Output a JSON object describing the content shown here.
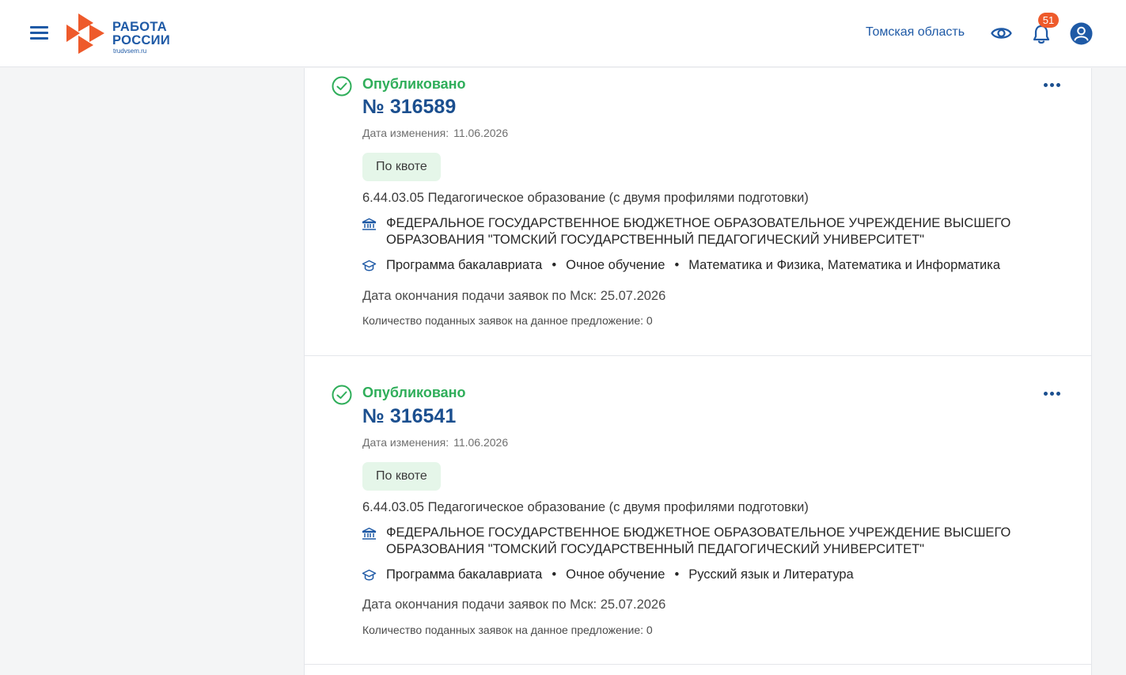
{
  "header": {
    "logo_line1": "РАБОТА",
    "logo_line2": "РОССИИ",
    "logo_sub": "trudvsem.ru",
    "region": "Томская область",
    "notifications_count": "51",
    "icons": [
      "menu-icon",
      "eye-icon",
      "bell-icon",
      "user-icon"
    ]
  },
  "colors": {
    "brand_blue": "#1f5aa6",
    "brand_orange": "#ee5a2b",
    "status_green": "#2fae5a",
    "chip_bg": "#e5f6e9"
  },
  "cards": [
    {
      "status": "Опубликовано",
      "number": "№ 316589",
      "date_label": "Дата изменения:",
      "date_value": "11.06.2026",
      "chip": "По квоте",
      "specialty": "6.44.03.05 Педагогическое образование (с двумя профилями подготовки)",
      "org_line1": "ФЕДЕРАЛЬНОЕ ГОСУДАРСТВЕННОЕ БЮДЖЕТНОЕ ОБРАЗОВАТЕЛЬНОЕ УЧРЕЖДЕНИЕ ВЫСШЕГО",
      "org_line2": "ОБРАЗОВАНИЯ \"ТОМСКИЙ ГОСУДАРСТВЕННЫЙ ПЕДАГОГИЧЕСКИЙ УНИВЕРСИТЕТ\"",
      "program": "Программа бакалавриата",
      "form": "Очное обучение",
      "profiles": "Математика и Физика, Математика и Информатика",
      "deadline": "Дата окончания подачи заявок по Мск: 25.07.2026",
      "applications": "Количество поданных заявок на данное предложение: 0"
    },
    {
      "status": "Опубликовано",
      "number": "№ 316541",
      "date_label": "Дата изменения:",
      "date_value": "11.06.2026",
      "chip": "По квоте",
      "specialty": "6.44.03.05 Педагогическое образование (с двумя профилями подготовки)",
      "org_line1": "ФЕДЕРАЛЬНОЕ ГОСУДАРСТВЕННОЕ БЮДЖЕТНОЕ ОБРАЗОВАТЕЛЬНОЕ УЧРЕЖДЕНИЕ ВЫСШЕГО",
      "org_line2": "ОБРАЗОВАНИЯ \"ТОМСКИЙ ГОСУДАРСТВЕННЫЙ ПЕДАГОГИЧЕСКИЙ УНИВЕРСИТЕТ\"",
      "program": "Программа бакалавриата",
      "form": "Очное обучение",
      "profiles": "Русский язык и Литература",
      "deadline": "Дата окончания подачи заявок по Мск: 25.07.2026",
      "applications": "Количество поданных заявок на данное предложение: 0"
    }
  ]
}
